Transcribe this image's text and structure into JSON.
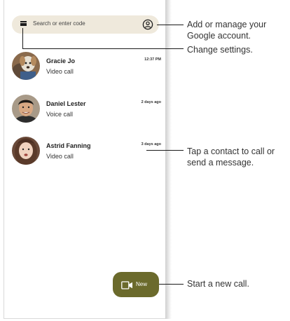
{
  "search": {
    "placeholder": "Search or enter code",
    "menu_icon": "menu-icon",
    "account_icon": "account-circle-icon"
  },
  "contacts": [
    {
      "name": "Gracie Jo",
      "call_type": "Video call",
      "time": "12:37 PM"
    },
    {
      "name": "Daniel Lester",
      "call_type": "Voice call",
      "time": "2 days ago"
    },
    {
      "name": "Astrid Fanning",
      "call_type": "Video call",
      "time": "3 days ago"
    }
  ],
  "new_button": {
    "label": "New",
    "icon": "video-camera-icon"
  },
  "callouts": {
    "account_line1": "Add or manage your",
    "account_line2": "Google account.",
    "settings": "Change settings.",
    "contact_line1": "Tap a contact to call or",
    "contact_line2": "send a message.",
    "new_call": "Start a new call."
  },
  "colors": {
    "search_bg": "#efe9dc",
    "new_button_bg": "#6b6a2c",
    "callout_text": "#333333"
  }
}
